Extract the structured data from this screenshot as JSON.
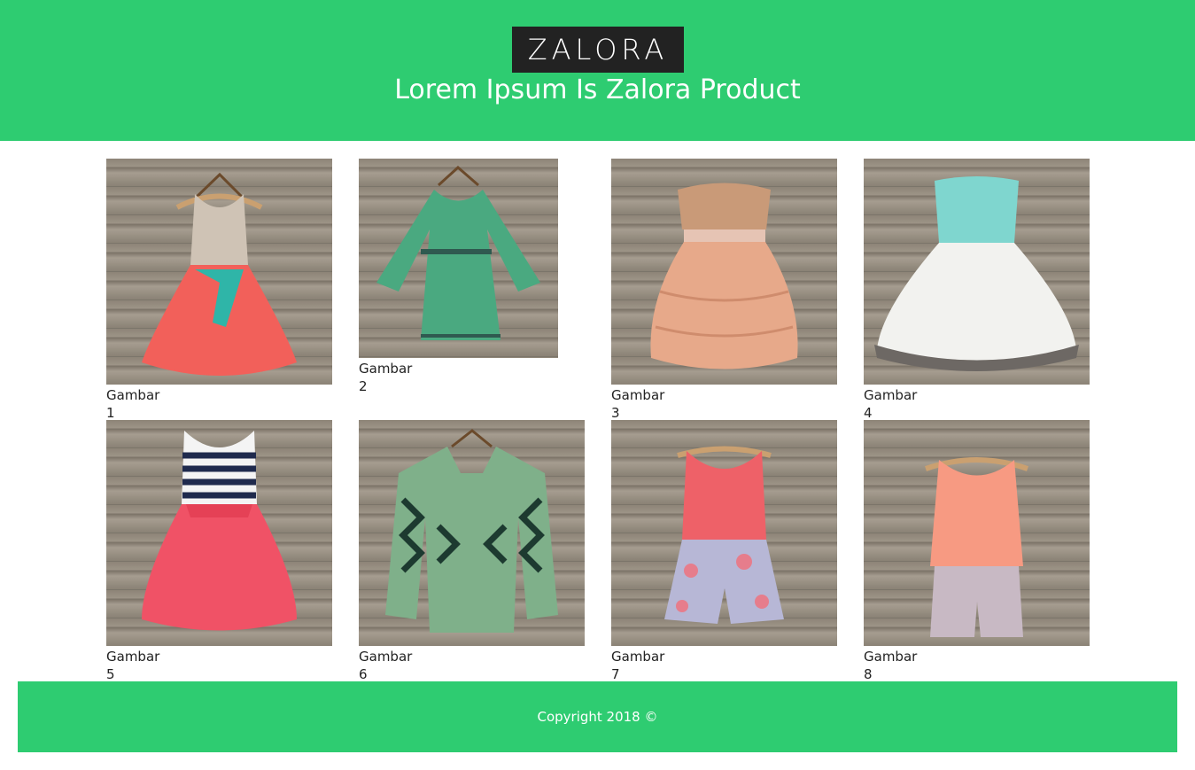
{
  "header": {
    "logo_text": "ZALORA",
    "tagline": "Lorem Ipsum Is Zalora Product",
    "background": "#2ecc71"
  },
  "gallery": {
    "items": [
      {
        "caption": "Gambar 1",
        "image": "coral-skirt-sleeveless-dress-teal-bow"
      },
      {
        "caption": "Gambar 2",
        "image": "green-chiffon-long-sleeve-dress"
      },
      {
        "caption": "Gambar 3",
        "image": "sequin-strapless-peach-ruffle-dress"
      },
      {
        "caption": "Gambar 4",
        "image": "mint-white-ruffle-dress"
      },
      {
        "caption": "Gambar 5",
        "image": "navy-stripe-pink-skirt-dress"
      },
      {
        "caption": "Gambar 6",
        "image": "green-aztec-cardigan"
      },
      {
        "caption": "Gambar 7",
        "image": "coral-top-floral-romper"
      },
      {
        "caption": "Gambar 8",
        "image": "peach-top-sequin-romper"
      }
    ]
  },
  "footer": {
    "copyright": "Copyright 2018 ©"
  }
}
